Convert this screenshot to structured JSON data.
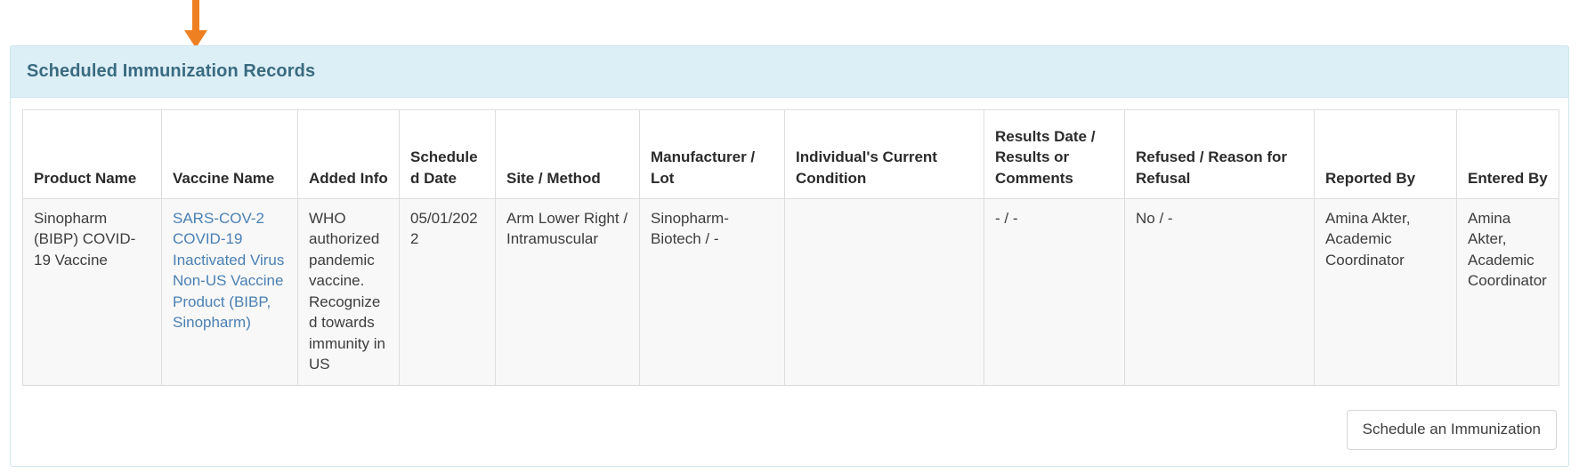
{
  "annotation": {
    "arrow_color": "#ef8022",
    "arrow_icon": "arrow-down-icon"
  },
  "card": {
    "title": "Scheduled Immunization Records",
    "header_bg": "#ddeff6",
    "title_color": "#3a6b80",
    "border_color": "#cfe6ee"
  },
  "table": {
    "columns": [
      "Product Name",
      "Vaccine Name",
      "Added Info",
      "Scheduled Date",
      "Site / Method",
      "Manufacturer / Lot",
      "Individual's Current Condition",
      "Results Date / Results or Comments",
      "Refused / Reason for Refusal",
      "Reported By",
      "Entered By"
    ],
    "rows": [
      {
        "product_name": "Sinopharm (BIBP) COVID-19 Vaccine",
        "vaccine_name": "SARS-COV-2 COVID-19 Inactivated Virus Non-US Vaccine Product (BIBP, Sinopharm)",
        "vaccine_name_is_link": true,
        "added_info": "WHO authorized pandemic vaccine. Recognized towards immunity in US",
        "scheduled_date": "05/01/2022",
        "site_method": "Arm Lower Right / Intramuscular",
        "manufacturer_lot": "Sinopharm-Biotech / -",
        "current_condition": "",
        "results": "- / -",
        "refused": "No / -",
        "reported_by": "Amina Akter, Academic Coordinator",
        "entered_by": "Amina Akter, Academic Coordinator"
      }
    ],
    "link_color": "#4a80b4"
  },
  "footer": {
    "schedule_button_label": "Schedule an Immunization"
  }
}
